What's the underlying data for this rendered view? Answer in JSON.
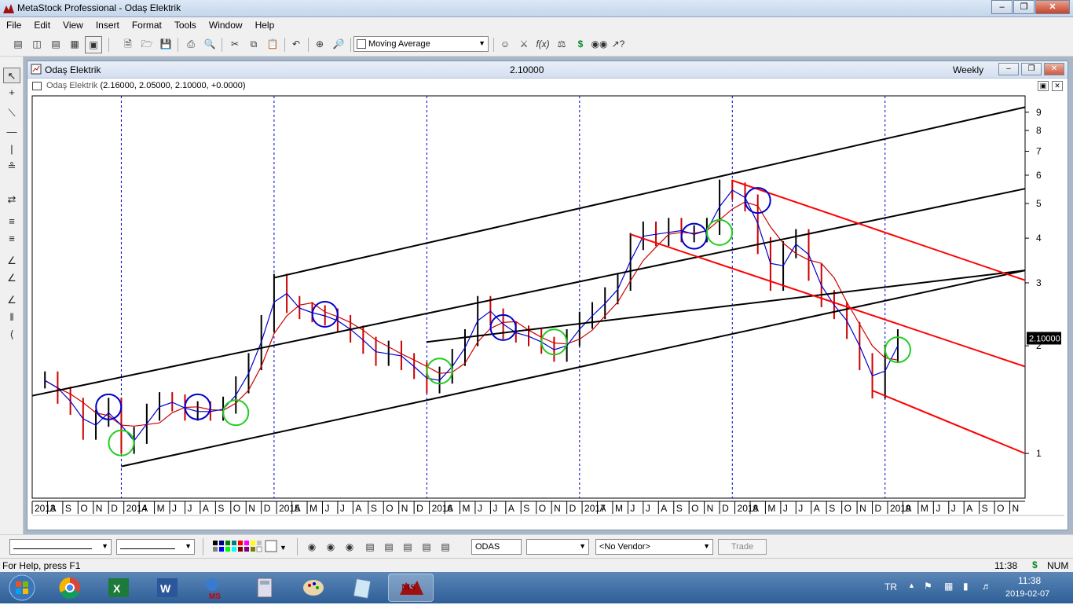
{
  "app": {
    "title": "MetaStock Professional - Odaş Elektrik"
  },
  "menu": [
    "File",
    "Edit",
    "View",
    "Insert",
    "Format",
    "Tools",
    "Window",
    "Help"
  ],
  "toolbar": {
    "indicator_select": "Moving Average"
  },
  "chart_window": {
    "title": "Odaş Elektrik",
    "last_value": "2.10000",
    "periodicity": "Weekly",
    "plot_name": "Odaş Elektrik",
    "plot_values": "(2.16000, 2.05000, 2.10000, +0.0000)",
    "price_tag": "2.10000"
  },
  "bottom_toolbar": {
    "symbol": "ODAS",
    "vendor": "<No Vendor>",
    "trade_label": "Trade"
  },
  "status": {
    "help": "For Help, press F1",
    "time": "11:38",
    "num": "NUM",
    "dollar": "$"
  },
  "taskbar": {
    "lang": "TR",
    "clock_time": "11:38",
    "clock_date": "2019-02-07"
  },
  "colors": {
    "bull_bar": "#000000",
    "bear_bar": "#cc0000",
    "ma_fast": "#0000cc",
    "ma_slow": "#cc0000",
    "trend_channel": "#000000",
    "down_channel": "#ff0000",
    "circle_blue": "#0000cc",
    "circle_green": "#22cc22"
  },
  "chart_data": {
    "type": "line",
    "title": "",
    "xlabel": "",
    "ylabel": "",
    "y_scale": "log",
    "ylim": [
      0.75,
      10
    ],
    "y_ticks": [
      1,
      2,
      3,
      4,
      5,
      6,
      7,
      8,
      9
    ],
    "x_labels": [
      "2013",
      "A",
      "S",
      "O",
      "N",
      "D",
      "2014",
      "A",
      "M",
      "J",
      "J",
      "A",
      "S",
      "O",
      "N",
      "D",
      "2015",
      "A",
      "M",
      "J",
      "J",
      "A",
      "S",
      "O",
      "N",
      "D",
      "2016",
      "A",
      "M",
      "J",
      "J",
      "A",
      "S",
      "O",
      "N",
      "D",
      "2017",
      "A",
      "M",
      "J",
      "J",
      "A",
      "S",
      "O",
      "N",
      "D",
      "2018",
      "A",
      "M",
      "J",
      "J",
      "A",
      "S",
      "O",
      "N",
      "D",
      "2019",
      "A",
      "M",
      "J",
      "J",
      "A",
      "S",
      "O",
      "N"
    ],
    "year_dividers": [
      "2014",
      "2015",
      "2016",
      "2017",
      "2018",
      "2019"
    ],
    "price_series": [
      {
        "date": "2013-07",
        "close": 1.6
      },
      {
        "date": "2013-08",
        "close": 1.45
      },
      {
        "date": "2013-09",
        "close": 1.35
      },
      {
        "date": "2013-10",
        "close": 1.15
      },
      {
        "date": "2013-11",
        "close": 1.25
      },
      {
        "date": "2013-12",
        "close": 1.35
      },
      {
        "date": "2014-01",
        "close": 1.05
      },
      {
        "date": "2014-02",
        "close": 1.12
      },
      {
        "date": "2014-03",
        "close": 1.3
      },
      {
        "date": "2014-04",
        "close": 1.4
      },
      {
        "date": "2014-05",
        "close": 1.38
      },
      {
        "date": "2014-06",
        "close": 1.3
      },
      {
        "date": "2014-07",
        "close": 1.32
      },
      {
        "date": "2014-08",
        "close": 1.3
      },
      {
        "date": "2014-09",
        "close": 1.36
      },
      {
        "date": "2014-10",
        "close": 1.55
      },
      {
        "date": "2014-11",
        "close": 1.8
      },
      {
        "date": "2014-12",
        "close": 2.3
      },
      {
        "date": "2015-01",
        "close": 3.0
      },
      {
        "date": "2015-02",
        "close": 2.6
      },
      {
        "date": "2015-03",
        "close": 2.5
      },
      {
        "date": "2015-04",
        "close": 2.45
      },
      {
        "date": "2015-05",
        "close": 2.4
      },
      {
        "date": "2015-06",
        "close": 2.3
      },
      {
        "date": "2015-07",
        "close": 2.15
      },
      {
        "date": "2015-08",
        "close": 2.0
      },
      {
        "date": "2015-09",
        "close": 1.85
      },
      {
        "date": "2015-10",
        "close": 1.95
      },
      {
        "date": "2015-11",
        "close": 1.8
      },
      {
        "date": "2015-12",
        "close": 1.7
      },
      {
        "date": "2016-01",
        "close": 1.55
      },
      {
        "date": "2016-02",
        "close": 1.65
      },
      {
        "date": "2016-03",
        "close": 1.85
      },
      {
        "date": "2016-04",
        "close": 2.1
      },
      {
        "date": "2016-05",
        "close": 2.6
      },
      {
        "date": "2016-06",
        "close": 2.4
      },
      {
        "date": "2016-07",
        "close": 2.2
      },
      {
        "date": "2016-08",
        "close": 2.15
      },
      {
        "date": "2016-09",
        "close": 2.1
      },
      {
        "date": "2016-10",
        "close": 2.0
      },
      {
        "date": "2016-11",
        "close": 1.9
      },
      {
        "date": "2016-12",
        "close": 2.1
      },
      {
        "date": "2017-01",
        "close": 2.35
      },
      {
        "date": "2017-02",
        "close": 2.5
      },
      {
        "date": "2017-03",
        "close": 2.75
      },
      {
        "date": "2017-04",
        "close": 3.0
      },
      {
        "date": "2017-05",
        "close": 3.9
      },
      {
        "date": "2017-06",
        "close": 4.2
      },
      {
        "date": "2017-07",
        "close": 4.0
      },
      {
        "date": "2017-08",
        "close": 4.3
      },
      {
        "date": "2017-09",
        "close": 4.1
      },
      {
        "date": "2017-10",
        "close": 4.1
      },
      {
        "date": "2017-11",
        "close": 4.3
      },
      {
        "date": "2017-12",
        "close": 5.5
      },
      {
        "date": "2018-01",
        "close": 5.4
      },
      {
        "date": "2018-02",
        "close": 5.0
      },
      {
        "date": "2018-03",
        "close": 3.8
      },
      {
        "date": "2018-04",
        "close": 3.0
      },
      {
        "date": "2018-05",
        "close": 3.7
      },
      {
        "date": "2018-06",
        "close": 4.0
      },
      {
        "date": "2018-07",
        "close": 3.2
      },
      {
        "date": "2018-08",
        "close": 2.7
      },
      {
        "date": "2018-09",
        "close": 2.5
      },
      {
        "date": "2018-10",
        "close": 2.2
      },
      {
        "date": "2018-11",
        "close": 1.8
      },
      {
        "date": "2018-12",
        "close": 1.5
      },
      {
        "date": "2019-01",
        "close": 1.9
      },
      {
        "date": "2019-02",
        "close": 2.1
      }
    ],
    "trendlines": [
      {
        "name": "channel-top",
        "color": "#000000",
        "from": {
          "date": "2015-01",
          "price": 3.1
        },
        "to": {
          "date": "2019-12",
          "price": 9.3
        }
      },
      {
        "name": "channel-mid-upper",
        "color": "#000000",
        "from": {
          "date": "2013-06",
          "price": 1.45
        },
        "to": {
          "date": "2019-12",
          "price": 5.5
        }
      },
      {
        "name": "channel-mid-lower",
        "color": "#000000",
        "from": {
          "date": "2016-01",
          "price": 2.05
        },
        "to": {
          "date": "2019-12",
          "price": 3.25
        }
      },
      {
        "name": "channel-bottom",
        "color": "#000000",
        "from": {
          "date": "2014-01",
          "price": 0.92
        },
        "to": {
          "date": "2019-12",
          "price": 3.25
        }
      },
      {
        "name": "down-top",
        "color": "#ff0000",
        "from": {
          "date": "2018-01",
          "price": 5.8
        },
        "to": {
          "date": "2019-12",
          "price": 3.05
        }
      },
      {
        "name": "down-mid",
        "color": "#ff0000",
        "from": {
          "date": "2017-05",
          "price": 4.1
        },
        "to": {
          "date": "2019-12",
          "price": 1.75
        }
      },
      {
        "name": "down-bottom",
        "color": "#ff0000",
        "from": {
          "date": "2018-12",
          "price": 1.5
        },
        "to": {
          "date": "2019-12",
          "price": 1.0
        }
      }
    ],
    "circles": [
      {
        "date": "2013-12",
        "price": 1.35,
        "color": "blue"
      },
      {
        "date": "2014-01",
        "price": 1.07,
        "color": "green"
      },
      {
        "date": "2014-07",
        "price": 1.35,
        "color": "blue"
      },
      {
        "date": "2014-10",
        "price": 1.3,
        "color": "green"
      },
      {
        "date": "2015-05",
        "price": 2.45,
        "color": "blue"
      },
      {
        "date": "2016-02",
        "price": 1.7,
        "color": "green"
      },
      {
        "date": "2016-07",
        "price": 2.25,
        "color": "blue"
      },
      {
        "date": "2016-11",
        "price": 2.05,
        "color": "green"
      },
      {
        "date": "2017-10",
        "price": 4.05,
        "color": "blue"
      },
      {
        "date": "2017-12",
        "price": 4.15,
        "color": "green"
      },
      {
        "date": "2018-03",
        "price": 5.1,
        "color": "blue"
      },
      {
        "date": "2019-02",
        "price": 1.95,
        "color": "green"
      }
    ]
  }
}
